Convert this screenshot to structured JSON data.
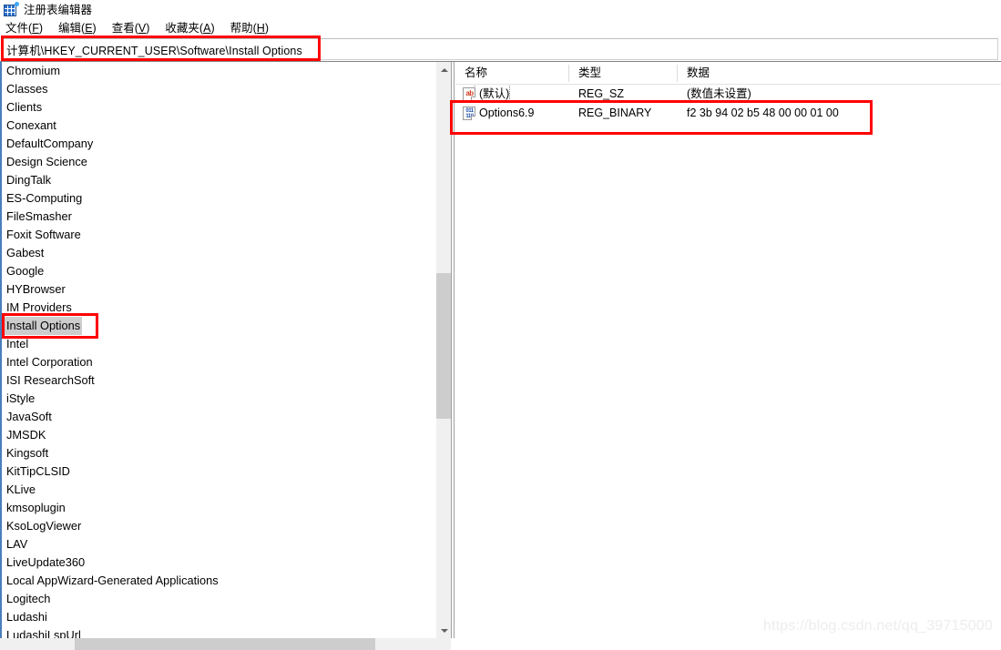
{
  "window": {
    "title": "注册表编辑器",
    "icon": "registry-editor-icon"
  },
  "menubar": {
    "items": [
      {
        "label": "文件",
        "accel": "F"
      },
      {
        "label": "编辑",
        "accel": "E"
      },
      {
        "label": "查看",
        "accel": "V"
      },
      {
        "label": "收藏夹",
        "accel": "A"
      },
      {
        "label": "帮助",
        "accel": "H"
      }
    ]
  },
  "address": {
    "value": "计算机\\HKEY_CURRENT_USER\\Software\\Install Options",
    "placeholder": ""
  },
  "tree": {
    "items": [
      {
        "label": "Chromium",
        "selected": false
      },
      {
        "label": "Classes",
        "selected": false
      },
      {
        "label": "Clients",
        "selected": false
      },
      {
        "label": "Conexant",
        "selected": false
      },
      {
        "label": "DefaultCompany",
        "selected": false
      },
      {
        "label": "Design Science",
        "selected": false
      },
      {
        "label": "DingTalk",
        "selected": false
      },
      {
        "label": "ES-Computing",
        "selected": false
      },
      {
        "label": "FileSmasher",
        "selected": false
      },
      {
        "label": "Foxit Software",
        "selected": false
      },
      {
        "label": "Gabest",
        "selected": false
      },
      {
        "label": "Google",
        "selected": false
      },
      {
        "label": "HYBrowser",
        "selected": false
      },
      {
        "label": "IM Providers",
        "selected": false
      },
      {
        "label": "Install Options",
        "selected": true
      },
      {
        "label": "Intel",
        "selected": false
      },
      {
        "label": "Intel Corporation",
        "selected": false
      },
      {
        "label": "ISI ResearchSoft",
        "selected": false
      },
      {
        "label": "iStyle",
        "selected": false
      },
      {
        "label": "JavaSoft",
        "selected": false
      },
      {
        "label": "JMSDK",
        "selected": false
      },
      {
        "label": "Kingsoft",
        "selected": false
      },
      {
        "label": "KitTipCLSID",
        "selected": false
      },
      {
        "label": "KLive",
        "selected": false
      },
      {
        "label": "kmsoplugin",
        "selected": false
      },
      {
        "label": "KsoLogViewer",
        "selected": false
      },
      {
        "label": "LAV",
        "selected": false
      },
      {
        "label": "LiveUpdate360",
        "selected": false
      },
      {
        "label": "Local AppWizard-Generated Applications",
        "selected": false
      },
      {
        "label": "Logitech",
        "selected": false
      },
      {
        "label": "Ludashi",
        "selected": false
      },
      {
        "label": "LudashiLspUrl",
        "selected": false
      }
    ]
  },
  "values": {
    "columns": [
      "名称",
      "类型",
      "数据"
    ],
    "rows": [
      {
        "icon": "string-value-icon",
        "icon_glyph": "ab",
        "name": "(默认)",
        "type": "REG_SZ",
        "data": "(数值未设置)",
        "focused": true,
        "highlighted": false
      },
      {
        "icon": "binary-value-icon",
        "icon_glyph": "011",
        "icon_glyph2": "110",
        "name": "Options6.9",
        "type": "REG_BINARY",
        "data": "f2 3b 94 02 b5 48 00 00 01 00",
        "focused": false,
        "highlighted": true
      }
    ]
  },
  "annotations": {
    "color": "#ff0000",
    "boxes": [
      "address-bar",
      "install-options-key",
      "options-value-row"
    ]
  },
  "watermark": {
    "text": "https://blog.csdn.net/qq_39715000"
  }
}
